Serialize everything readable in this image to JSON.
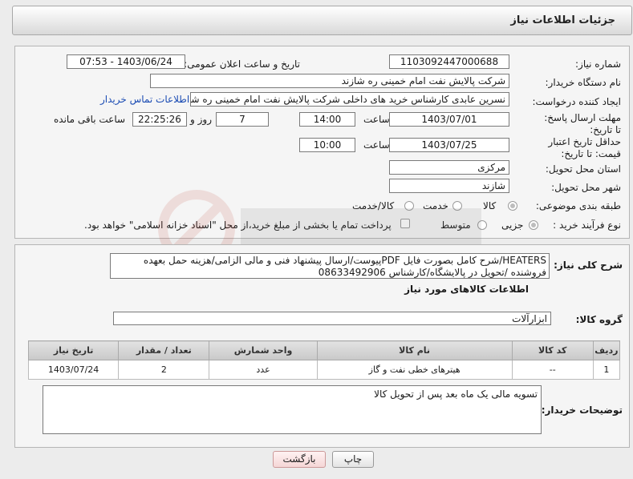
{
  "header": {
    "title": "جزئیات اطلاعات نیاز"
  },
  "fields": {
    "need_number_label": "شماره نیاز:",
    "need_number": "1103092447000688",
    "announce_label": "تاریخ و ساعت اعلان عمومی:",
    "announce_value": "1403/06/24 - 07:53",
    "buyer_org_label": "نام دستگاه خریدار:",
    "buyer_org": "شرکت پالایش نفت امام خمینی  ره  شازند",
    "creator_label": "ایجاد کننده درخواست:",
    "creator": "نسرین عابدی کارشناس خرید های داخلی  شرکت پالایش نفت امام خمینی  ره  شازند",
    "contact_link": "اطلاعات تماس خریدار",
    "deadline_label": "مهلت ارسال پاسخ: تا تاریخ:",
    "deadline_date": "1403/07/01",
    "time_label": "ساعت",
    "deadline_time": "14:00",
    "days_value": "7",
    "days_label": "روز و",
    "remaining_time": "22:25:26",
    "remaining_label": "ساعت باقی مانده",
    "validity_label": "حداقل تاریخ اعتبار قیمت: تا تاریخ:",
    "validity_date": "1403/07/25",
    "validity_time": "10:00",
    "province_label": "استان محل تحویل:",
    "province": "مرکزی",
    "city_label": "شهر محل تحویل:",
    "city": "شازند",
    "category_label": "طبقه بندی موضوعی:",
    "category_options": [
      "کالا",
      "خدمت",
      "کالا/خدمت"
    ],
    "process_label": "نوع فرآیند خرید :",
    "process_options": [
      "جزیی",
      "متوسط"
    ],
    "payment_note": "پرداخت تمام یا بخشی از مبلغ خرید،از محل \"اسناد خزانه اسلامی\" خواهد بود."
  },
  "description": {
    "label": "شرح کلی نیاز:",
    "text": "HEATERS/شرح کامل بصورت فایل PDFپیوست/ارسال پیشنهاد فنی و مالی الزامی/هزینه حمل بعهده فروشنده /تحویل در پالایشگاه/کارشناس 08633492906"
  },
  "items_section": {
    "title": "اطلاعات کالاهای مورد نیاز",
    "group_label": "گروه کالا:",
    "group_value": "ابزارآلات",
    "columns": [
      "ردیف",
      "کد کالا",
      "نام کالا",
      "واحد شمارش",
      "تعداد / مقدار",
      "تاریخ نیاز"
    ],
    "rows": [
      [
        "1",
        "--",
        "هیترهای خطی نفت و گاز",
        "عدد",
        "2",
        "1403/07/24"
      ]
    ]
  },
  "buyer_notes": {
    "label": "توضیحات خریدار:",
    "text": "تسویه مالی یک ماه بعد پس از تحویل کالا"
  },
  "buttons": {
    "print": "چاپ",
    "back": "بازگشت"
  }
}
